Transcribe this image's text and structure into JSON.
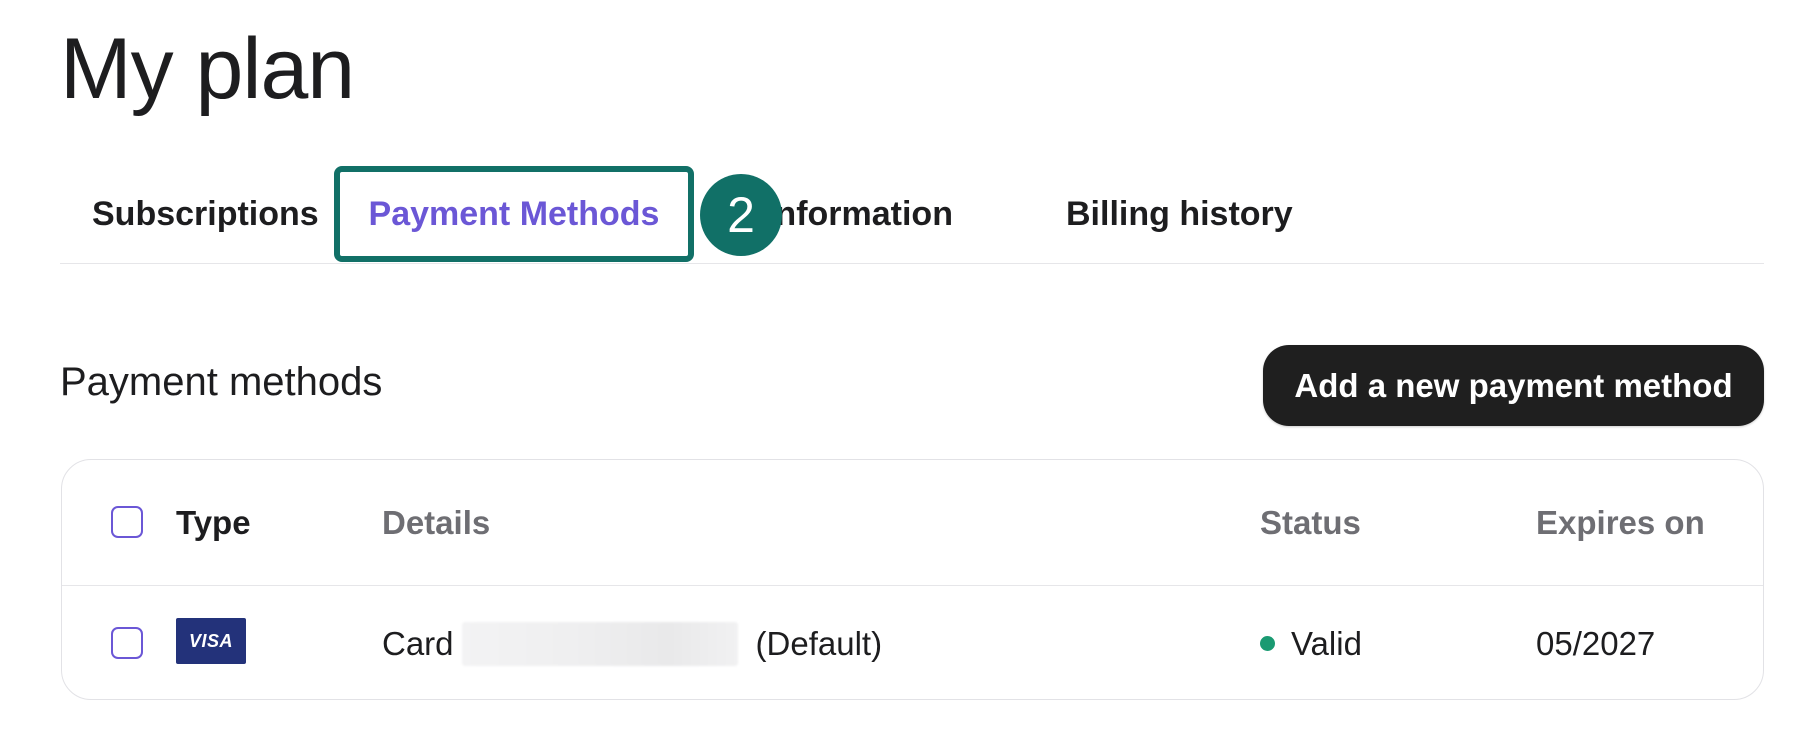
{
  "page": {
    "title": "My plan"
  },
  "tabs": [
    {
      "label": "Subscriptions",
      "active": false
    },
    {
      "label": "Payment Methods",
      "active": true
    },
    {
      "label": "Billing information",
      "active": false,
      "visible_text": "ng information"
    },
    {
      "label": "Billing history",
      "active": false
    }
  ],
  "step_badge": {
    "number": "2",
    "color": "#117067"
  },
  "section": {
    "title": "Payment methods",
    "add_button_label": "Add a new payment method"
  },
  "table": {
    "columns": [
      "Type",
      "Details",
      "Status",
      "Expires on"
    ],
    "rows": [
      {
        "type": "VISA",
        "details_prefix": "Card",
        "details_suffix": "(Default)",
        "status": "Valid",
        "status_color": "#1a9a72",
        "expires_on": "05/2027"
      }
    ]
  },
  "colors": {
    "accent": "#6b57d6",
    "highlight": "#117067",
    "button_bg": "#1f1f1f"
  }
}
